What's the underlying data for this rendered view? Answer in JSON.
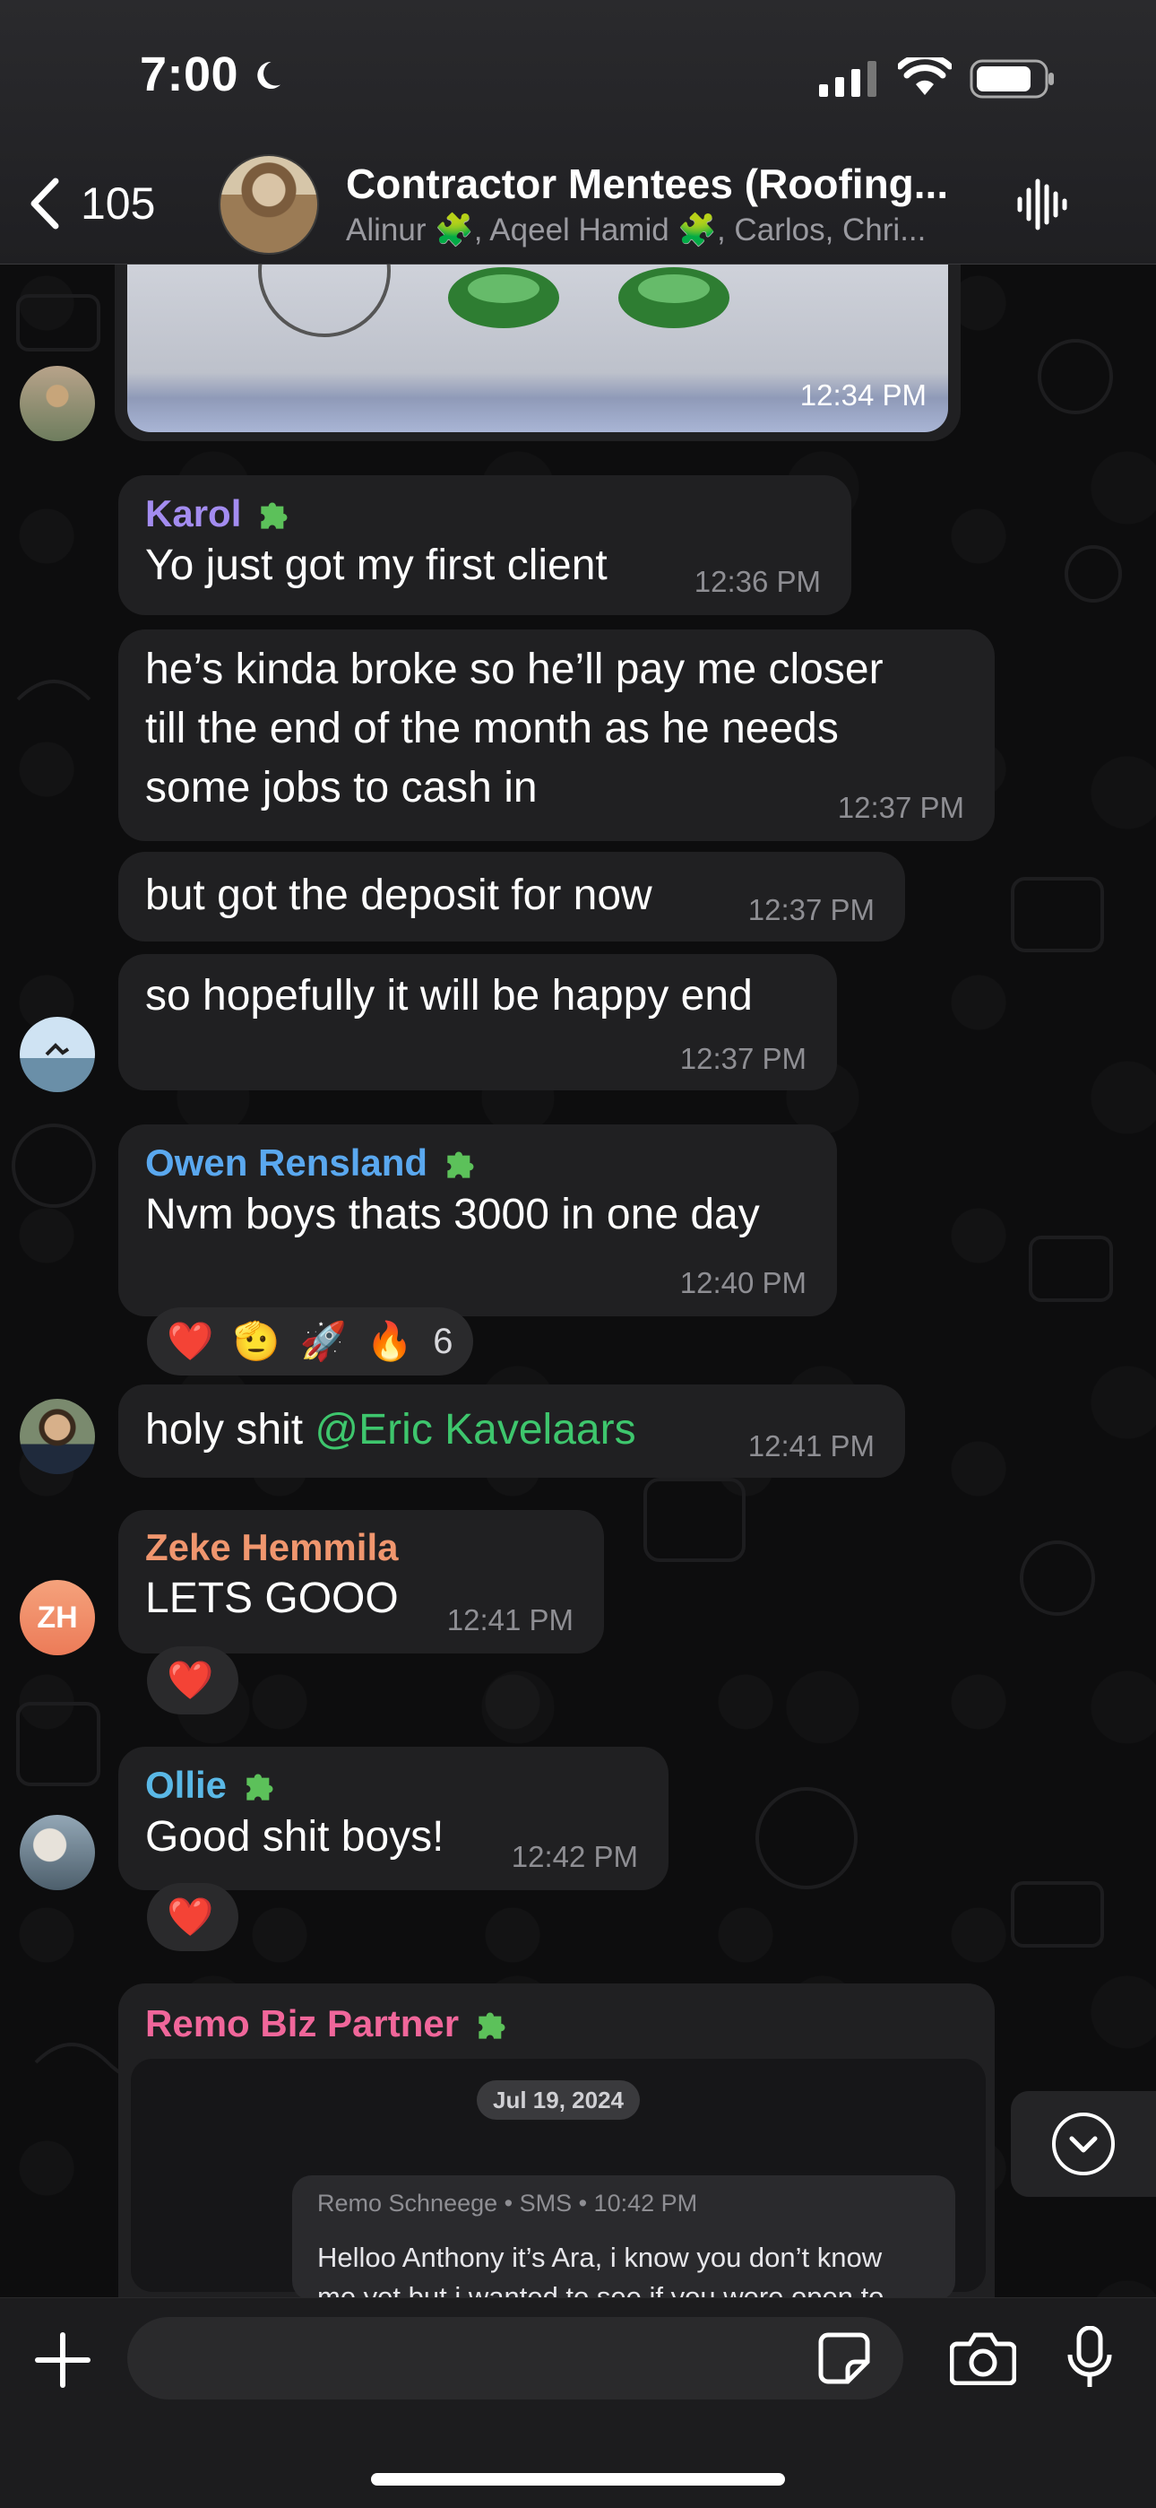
{
  "status_bar": {
    "time": "7:00",
    "focus_icon": "moon-icon"
  },
  "header": {
    "back_count": "105",
    "title": "Contractor Mentees (Roofing...",
    "subtitle": "Alinur 🧩, Aqeel Hamid 🧩, Carlos, Chri...",
    "action_icon": "voice-chat-icon"
  },
  "messages": [
    {
      "kind": "photo",
      "time": "12:34 PM"
    },
    {
      "sender": "Karol",
      "sender_color": "#a38cf0",
      "text": "Yo just got my first client",
      "time": "12:36 PM"
    },
    {
      "text_lines": [
        "he’s kinda broke so he’ll pay me closer",
        "till the end of the month as he needs",
        "some jobs to cash in"
      ],
      "time": "12:37 PM"
    },
    {
      "text": "but got the deposit for now",
      "time": "12:37 PM"
    },
    {
      "text": "so hopefully it will be happy end",
      "time": "12:37 PM"
    },
    {
      "sender": "Owen Rensland",
      "sender_color": "#5aa8ef",
      "text": "Nvm boys thats 3000 in one day",
      "time": "12:40 PM",
      "reactions": [
        "❤️",
        "🫡",
        "🚀",
        "🔥"
      ],
      "reaction_count": "6"
    },
    {
      "text_prefix": "holy shit ",
      "mention": "@Eric Kavelaars",
      "time": "12:41 PM"
    },
    {
      "sender": "Zeke Hemmila",
      "sender_color": "#f0966e",
      "avatar_initials": "ZH",
      "text": "LETS GOOO",
      "time": "12:41 PM",
      "reactions": [
        "❤️"
      ]
    },
    {
      "sender": "Ollie",
      "sender_color": "#5ab8e6",
      "text": "Good shit boys!",
      "time": "12:42 PM",
      "reactions": [
        "❤️"
      ]
    },
    {
      "sender": "Remo Biz Partner",
      "sender_color": "#f0669a",
      "forward_date": "Jul 19, 2024",
      "sms_meta": "Remo Schneege • SMS • 10:42 PM",
      "sms_text": "Helloo Anthony it’s Ara, i know you don’t know",
      "sms_text_2": "me yet but i wanted to see if you were open to"
    }
  ],
  "composer": {
    "placeholder": ""
  }
}
